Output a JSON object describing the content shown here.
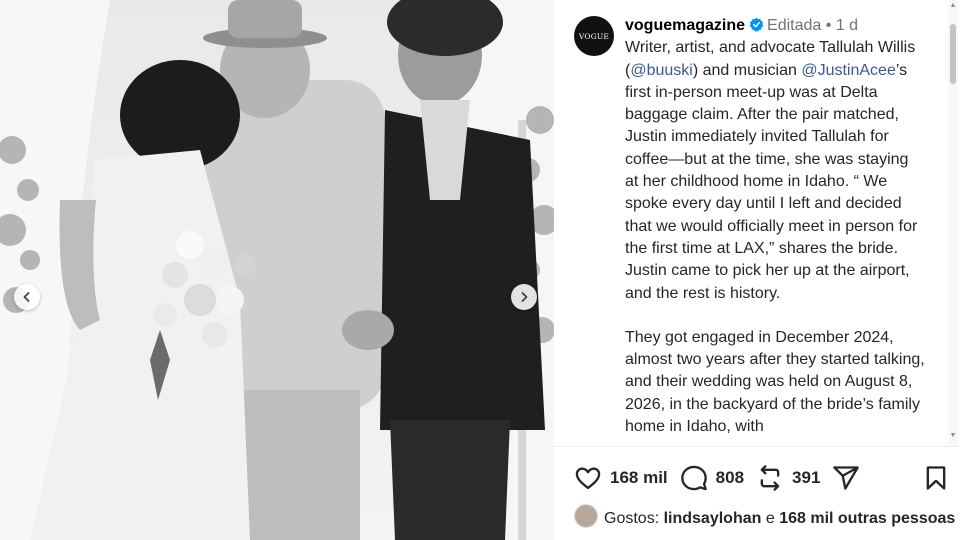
{
  "post": {
    "username": "voguemagazine",
    "avatar_text": "VOGUE",
    "edited_label": "Editada",
    "separator": "•",
    "time_ago": "1 d",
    "caption": {
      "p1_prefix": "Writer, artist, and advocate Tallulah Willis (",
      "mention1": "@buuski",
      "p1_mid": ") and musician ",
      "mention2": "@JustinAcee",
      "p1_rest": "’s first in-person meet-up was at Delta baggage claim. After the pair matched, Justin immediately invited Tallulah for coffee—but at the time, she was staying at her childhood home in Idaho. “ We spoke every day until I left and decided that we would officially meet in person for the first time at LAX,” shares the bride. Justin came to pick her up at the airport, and the rest is history.",
      "p2": "They got engaged in December 2024, almost two years after they started talking, and their wedding was held on August 8, 2026, in the backyard of the bride’s family home in Idaho, with"
    }
  },
  "actions": {
    "like_count": "168 mil",
    "comment_count": "808",
    "repost_count": "391"
  },
  "likes": {
    "prefix": "Gostos:",
    "user": "lindsaylohan",
    "connector": "e",
    "others": "168 mil outras pessoas"
  },
  "icons": {
    "verified": "verified-badge-icon",
    "like": "heart-icon",
    "comment": "comment-bubble-icon",
    "repost": "repost-icon",
    "share": "send-icon",
    "save": "bookmark-icon",
    "prev": "chevron-left-icon",
    "next": "chevron-right-icon"
  },
  "colors": {
    "verified": "#0095f6",
    "mention": "#385898",
    "text": "#262626",
    "meta": "#737373"
  }
}
